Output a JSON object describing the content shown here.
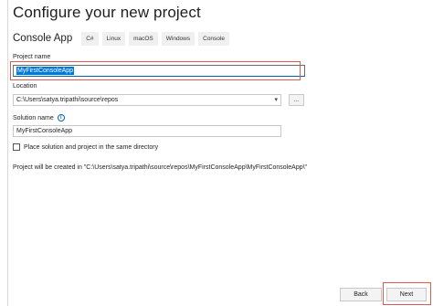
{
  "window": {
    "title": "Configure your new project"
  },
  "template": {
    "name": "Console App",
    "tags": [
      "C#",
      "Linux",
      "macOS",
      "Windows",
      "Console"
    ]
  },
  "project_name": {
    "label": "Project name",
    "value": "MyFirstConsoleApp"
  },
  "location": {
    "label": "Location",
    "value": "C:\\Users\\satya.tripathi\\source\\repos",
    "browse_label": "..."
  },
  "solution_name": {
    "label": "Solution name",
    "info_icon": "i",
    "value": "MyFirstConsoleApp"
  },
  "same_directory": {
    "label": "Place solution and project in the same directory",
    "checked": false
  },
  "path_info": "Project will be created in \"C:\\Users\\satya.tripathi\\source\\repos\\MyFirstConsoleApp\\MyFirstConsoleApp\\\"",
  "footer": {
    "back_label": "Back",
    "next_label": "Next"
  },
  "icons": {
    "dropdown": "chevron-down-icon",
    "info": "info-icon"
  },
  "colors": {
    "selection": "#0078d7",
    "highlight": "#e05a4e",
    "focus": "#0063b1"
  }
}
